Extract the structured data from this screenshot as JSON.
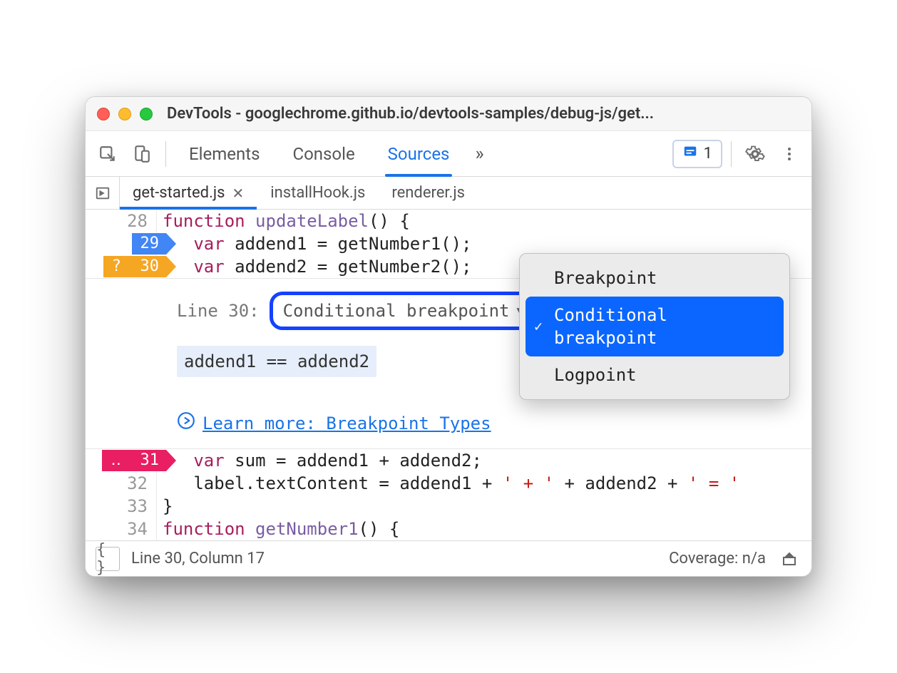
{
  "window": {
    "title": "DevTools - googlechrome.github.io/devtools-samples/debug-js/get..."
  },
  "tabs": {
    "elements": "Elements",
    "console": "Console",
    "sources": "Sources",
    "issues_count": "1"
  },
  "file_tabs": {
    "active": "get-started.js",
    "tab2": "installHook.js",
    "tab3": "renderer.js"
  },
  "code": {
    "l28_num": "28",
    "l28_kw": "function",
    "l28_fn": " updateLabel",
    "l28_rest": "() {",
    "l29_num": "29",
    "l29_indent": "   ",
    "l29_kw": "var",
    "l29_rest": " addend1 = getNumber1();",
    "l30_num": "30",
    "l30_marker": "?",
    "l30_indent": "   ",
    "l30_kw": "var",
    "l30_rest": " addend2 = getNumber2();",
    "l31_num": "31",
    "l31_marker": "‥",
    "l31_indent": "   ",
    "l31_kw": "var",
    "l31_rest": " sum = addend1 + addend2;",
    "l32_num": "32",
    "l32_a": "   label.textContent = addend1 + ",
    "l32_s1": "' + '",
    "l32_b": " + addend2 + ",
    "l32_s2": "' = '",
    "l33_num": "33",
    "l33": "}",
    "l34_num": "34",
    "l34_kw": "function",
    "l34_fn": " getNumber1",
    "l34_rest": "() {"
  },
  "bp_editor": {
    "line_label": "Line 30:",
    "type_label": "Conditional breakpoint",
    "condition": "addend1 == addend2",
    "learn_more": "Learn more: Breakpoint Types"
  },
  "dropdown": {
    "opt1": "Breakpoint",
    "opt2": "Conditional breakpoint",
    "opt3": "Logpoint"
  },
  "status": {
    "pos": "Line 30, Column 17",
    "coverage": "Coverage: n/a"
  }
}
